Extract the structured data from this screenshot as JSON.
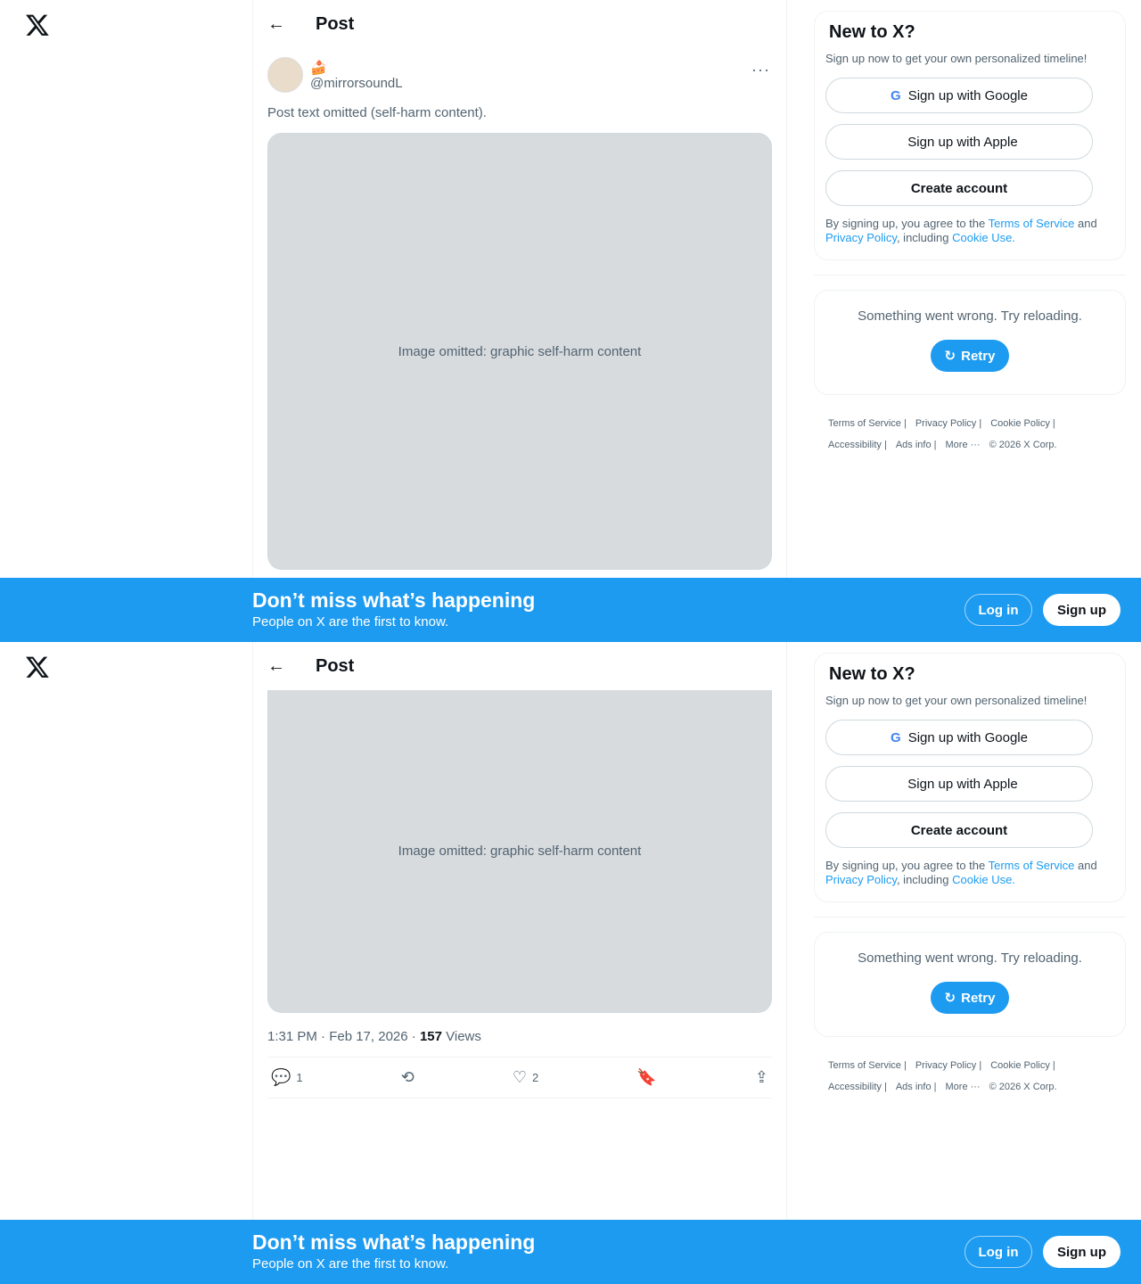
{
  "logo": "X",
  "header": {
    "title": "Post"
  },
  "post": {
    "display_name": "🍰",
    "handle": "@mirrorsoundL",
    "content_notice": "Post text omitted (self-harm content).",
    "media_placeholder": "Image omitted: graphic self-harm content",
    "time": "1:31 PM · Feb 17, 2026 · ",
    "views_count": "157",
    "views_label": " Views",
    "replies": "1",
    "likes": "2"
  },
  "signup": {
    "title": "New to X?",
    "subtitle": "Sign up now to get your own personalized timeline!",
    "google": "Sign up with Google",
    "apple": "Sign up with Apple",
    "create": "Create account",
    "terms_prefix": "By signing up, you agree to the ",
    "terms_link": "Terms of Service",
    "and": " and ",
    "privacy_link": "Privacy Policy",
    "including": ", including ",
    "cookie_link": "Cookie Use."
  },
  "error": {
    "message": "Something went wrong. Try reloading.",
    "retry": "Retry"
  },
  "footer": [
    "Terms of Service |",
    "Privacy Policy |",
    "Cookie Policy |",
    "Accessibility |",
    "Ads info |",
    "More ···",
    "© 2026 X Corp."
  ],
  "banner": {
    "title": "Don’t miss what’s happening",
    "subtitle": "People on X are the first to know.",
    "login": "Log in",
    "signup": "Sign up"
  }
}
